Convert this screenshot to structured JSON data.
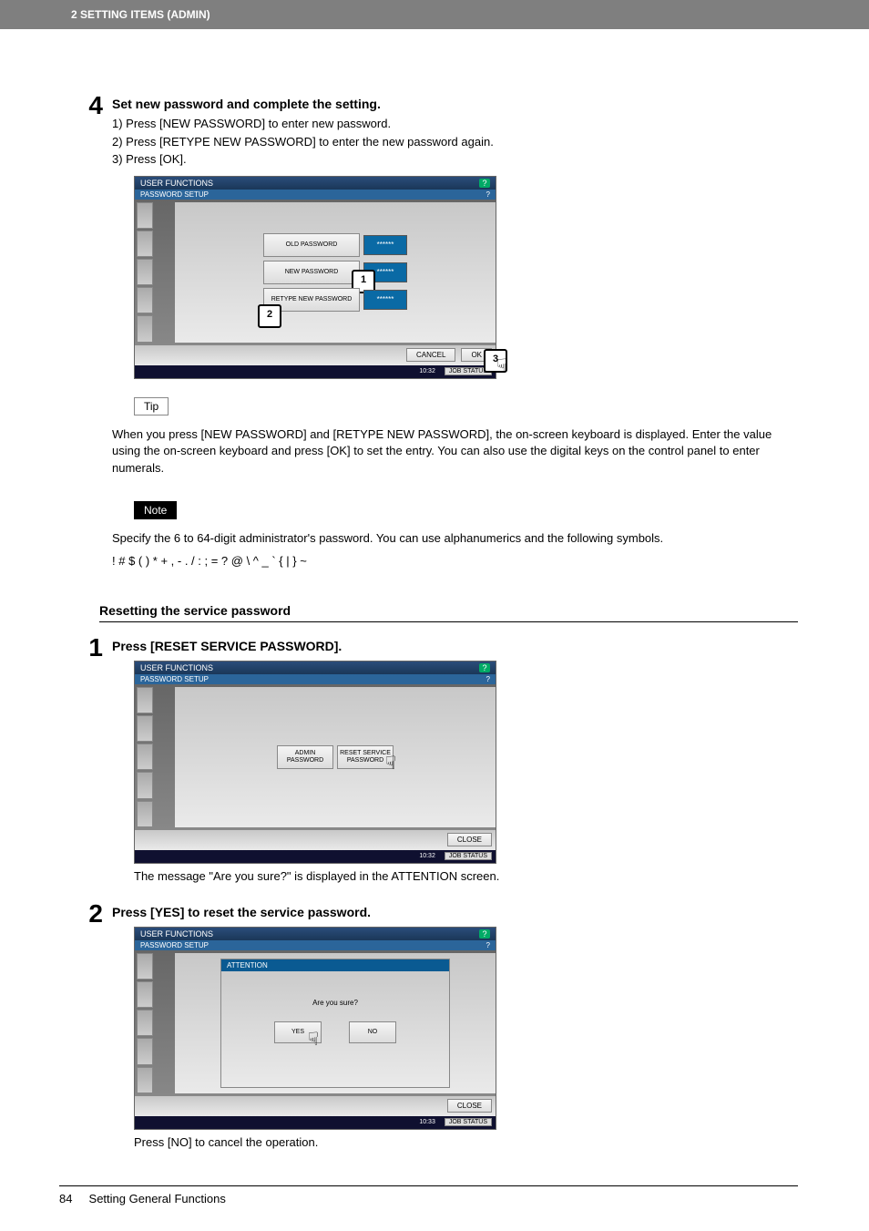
{
  "header": {
    "chapter": "2 SETTING ITEMS (ADMIN)"
  },
  "step4": {
    "num": "4",
    "title": "Set new password and complete the setting.",
    "sub1": "1)  Press [NEW PASSWORD] to enter new password.",
    "sub2": "2)  Press [RETYPE NEW PASSWORD] to enter the new password again.",
    "sub3": "3)  Press [OK].",
    "ss": {
      "title": "USER FUNCTIONS",
      "subtitle": "PASSWORD SETUP",
      "help": "?",
      "old": "OLD PASSWORD",
      "new": "NEW PASSWORD",
      "retype": "RETYPE NEW PASSWORD",
      "mask": "******",
      "cancel": "CANCEL",
      "ok": "OK",
      "time": "10:32",
      "jobstatus": "JOB STATUS",
      "m1": "1",
      "m2": "2",
      "m3": "3"
    },
    "tip_label": "Tip",
    "tip_text": "When you press [NEW PASSWORD] and [RETYPE NEW PASSWORD], the on-screen keyboard is displayed. Enter the value using the on-screen keyboard and press [OK] to set the entry. You can also use the digital keys on the control panel to enter numerals.",
    "note_label": "Note",
    "note_text1": "Specify the 6 to 64-digit administrator's password. You can use alphanumerics and the following symbols.",
    "note_text2": "! # $ ( ) * + , - . / : ; = ? @ \\ ^ _ ` { | } ~"
  },
  "section_reset": "Resetting the service password",
  "step1": {
    "num": "1",
    "title": "Press [RESET SERVICE PASSWORD].",
    "ss": {
      "title": "USER FUNCTIONS",
      "subtitle": "PASSWORD SETUP",
      "help": "?",
      "admin": "ADMIN PASSWORD",
      "reset": "RESET SERVICE PASSWORD",
      "close": "CLOSE",
      "time": "10:32",
      "jobstatus": "JOB STATUS"
    },
    "after": "The message \"Are you sure?\" is displayed in the ATTENTION screen."
  },
  "step2": {
    "num": "2",
    "title": "Press [YES] to reset the service password.",
    "ss": {
      "title": "USER FUNCTIONS",
      "subtitle": "PASSWORD SETUP",
      "help": "?",
      "attention": "ATTENTION",
      "question": "Are you sure?",
      "yes": "YES",
      "no": "NO",
      "close": "CLOSE",
      "time": "10:33",
      "jobstatus": "JOB STATUS"
    },
    "after": "Press [NO] to cancel the operation."
  },
  "footer": {
    "page": "84",
    "section": "Setting General Functions"
  }
}
